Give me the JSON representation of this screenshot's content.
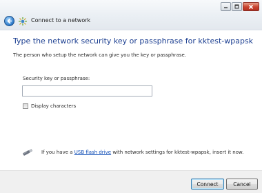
{
  "window": {
    "title": "Connect to a network",
    "controls": {
      "minimize": "minimize",
      "maximize": "maximize",
      "close": "close"
    }
  },
  "main": {
    "heading": "Type the network security key or passphrase for kktest-wpapsk",
    "description": "The person who setup the network can give you the key or passphrase.",
    "key_field": {
      "label": "Security key or passphrase:",
      "value": "",
      "placeholder": ""
    },
    "display_characters": {
      "label": "Display characters",
      "checked": false
    },
    "usb_hint": {
      "prefix": "If you have a ",
      "link": "USB flash drive",
      "suffix": " with network settings for kktest-wpapsk, insert it now."
    }
  },
  "footer": {
    "connect_label": "Connect",
    "cancel_label": "Cancel"
  },
  "colors": {
    "heading": "#1c3f91",
    "link": "#0a49b5",
    "close_button": "#c9432f"
  },
  "icons": {
    "back": "back-arrow-icon",
    "network": "network-icon",
    "usb": "usb-drive-icon"
  }
}
